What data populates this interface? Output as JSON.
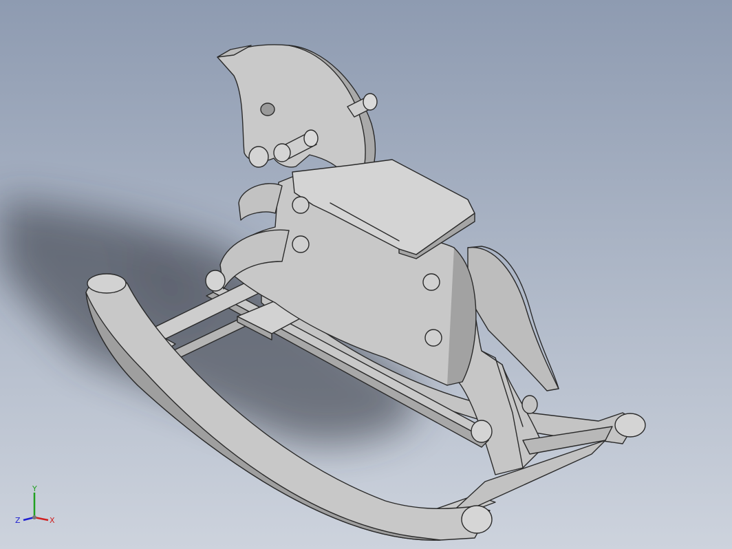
{
  "viewport": {
    "background_top": "#8e9bb1",
    "background_bottom": "#cdd3dd",
    "part_color": "#c8c8c8",
    "part_dark": "#9c9c9c",
    "edge_color": "#2a2a2a"
  },
  "triad": {
    "x_label": "X",
    "y_label": "Y",
    "z_label": "Z",
    "x_color": "#d02020",
    "y_color": "#20a020",
    "z_color": "#2020d0"
  }
}
